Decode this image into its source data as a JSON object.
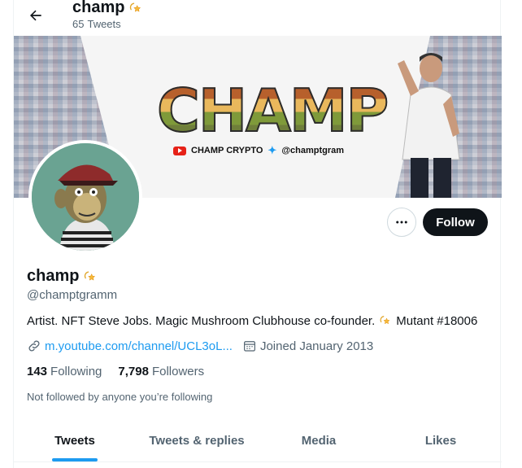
{
  "header": {
    "title": "champ",
    "tweet_count": "65",
    "tweet_count_label": "Tweets"
  },
  "banner": {
    "headline": "CHAMP",
    "channel": "CHAMP CRYPTO",
    "twitter_handle": "@champtgram"
  },
  "profile": {
    "name": "champ",
    "handle": "@champtgramm",
    "bio_before": "Artist. NFT Steve Jobs. Magic Mushroom Clubhouse co-founder.",
    "bio_after": "Mutant #18006",
    "website": "m.youtube.com/channel/UCL3oL...",
    "joined": "Joined January 2013",
    "following_count": "143",
    "following_label": "Following",
    "followers_count": "7,798",
    "followers_label": "Followers",
    "not_followed": "Not followed by anyone you’re following"
  },
  "actions": {
    "follow_label": "Follow"
  },
  "tabs": [
    {
      "label": "Tweets",
      "active": true
    },
    {
      "label": "Tweets & replies",
      "active": false
    },
    {
      "label": "Media",
      "active": false
    },
    {
      "label": "Likes",
      "active": false
    }
  ],
  "icons": {
    "back": "arrow-left-icon",
    "more": "more-horizontal-icon",
    "link": "link-icon",
    "calendar": "calendar-icon",
    "emoji": "dizzy-star-icon"
  },
  "colors": {
    "accent": "#1d9bf0",
    "text_primary": "#0f1419",
    "text_secondary": "#536471",
    "follow_bg": "#0f1419",
    "avatar_bg": "#6aa392"
  }
}
